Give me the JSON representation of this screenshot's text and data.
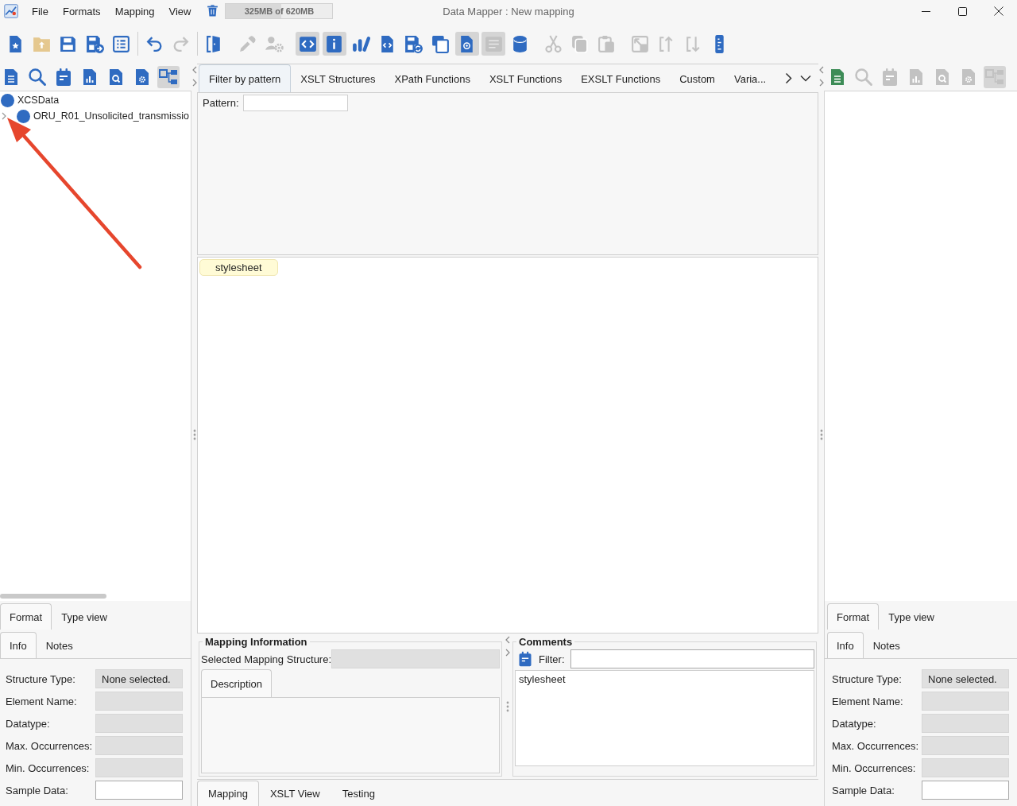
{
  "window": {
    "title": "Data Mapper : New mapping"
  },
  "menu": [
    "File",
    "Formats",
    "Mapping",
    "View"
  ],
  "memory": {
    "reading": "325MB of 620MB",
    "level": 0.52
  },
  "toolbar": {
    "groups": [
      {
        "divider": true,
        "tools": [
          {
            "disabled": false,
            "selected": false
          },
          {
            "disabled": false,
            "selected": false
          },
          {
            "disabled": false,
            "selected": false
          },
          {
            "disabled": false,
            "selected": false
          },
          {
            "disabled": false,
            "selected": false
          }
        ]
      },
      {
        "divider": true,
        "tools": [
          {
            "disabled": false,
            "selected": false
          },
          {
            "disabled": true,
            "selected": false
          }
        ]
      },
      {
        "divider": false,
        "tools": [
          {
            "disabled": false,
            "selected": false
          }
        ]
      },
      {
        "divider": false,
        "tools": [
          {
            "disabled": true,
            "selected": false
          },
          {
            "disabled": true,
            "selected": false
          }
        ]
      },
      {
        "divider": false,
        "tools": [
          {
            "disabled": false,
            "selected": true
          },
          {
            "disabled": false,
            "selected": true
          },
          {
            "disabled": false,
            "selected": false
          },
          {
            "disabled": false,
            "selected": false
          },
          {
            "disabled": false,
            "selected": false
          },
          {
            "disabled": false,
            "selected": false
          },
          {
            "disabled": false,
            "selected": true
          },
          {
            "disabled": true,
            "selected": true
          },
          {
            "disabled": false,
            "selected": false
          }
        ]
      },
      {
        "divider": false,
        "tools": [
          {
            "disabled": true,
            "selected": false
          },
          {
            "disabled": true,
            "selected": false
          },
          {
            "disabled": true,
            "selected": false
          }
        ]
      },
      {
        "divider": false,
        "tools": [
          {
            "disabled": true,
            "selected": false
          },
          {
            "disabled": true,
            "selected": false
          },
          {
            "disabled": true,
            "selected": false
          },
          {
            "disabled": false,
            "selected": false
          }
        ]
      }
    ]
  },
  "left_panel": {
    "tools": [
      {
        "disabled": false,
        "selected": false
      },
      {
        "disabled": false,
        "selected": false
      },
      {
        "disabled": false,
        "selected": false
      },
      {
        "disabled": false,
        "selected": false
      },
      {
        "disabled": false,
        "selected": false
      },
      {
        "disabled": false,
        "selected": false
      },
      {
        "disabled": false,
        "selected": true
      }
    ],
    "tree": [
      {
        "label": "XCSData",
        "children": [
          {
            "label": "ORU_R01_Unsolicited_transmissio",
            "expanded": false
          }
        ]
      }
    ],
    "annotations": [
      {
        "kind": "arrow"
      }
    ],
    "format_tabs": [
      {
        "label": "Format",
        "selected": true
      },
      {
        "label": "Type view",
        "selected": false
      }
    ],
    "info_tabs": [
      {
        "label": "Info",
        "selected": true
      },
      {
        "label": "Notes",
        "selected": false
      }
    ],
    "fields": [
      {
        "label": "Structure Type:",
        "value": "None selected.",
        "disabled": true
      },
      {
        "label": "Element Name:",
        "disabled": true
      },
      {
        "label": "Datatype:",
        "disabled": true
      },
      {
        "label": "Max. Occurrences:",
        "disabled": true
      },
      {
        "label": "Min. Occurrences:",
        "disabled": true
      },
      {
        "label": "Sample Data:",
        "disabled": false
      }
    ]
  },
  "center": {
    "tabs": [
      {
        "label": "Filter by pattern",
        "selected": true
      },
      {
        "label": "XSLT Structures",
        "selected": false
      },
      {
        "label": "XPath Functions",
        "selected": false
      },
      {
        "label": "XSLT Functions",
        "selected": false
      },
      {
        "label": "EXSLT Functions",
        "selected": false
      },
      {
        "label": "Custom",
        "selected": false
      },
      {
        "label": "Varia...",
        "selected": false
      }
    ],
    "pattern_label": "Pattern:",
    "canvas_nodes": [
      "stylesheet"
    ],
    "mapping_information": {
      "title": "Mapping Information",
      "structure_label": "Selected Mapping Structure:",
      "tabs": [
        {
          "label": "Description",
          "selected": true
        }
      ]
    },
    "comments": {
      "title": "Comments",
      "filter_label": "Filter:",
      "items": [
        "stylesheet"
      ]
    },
    "view_tabs": [
      {
        "label": "Mapping",
        "selected": true
      },
      {
        "label": "XSLT View",
        "selected": false
      },
      {
        "label": "Testing",
        "selected": false
      }
    ]
  },
  "right_panel": {
    "tools": [
      {
        "disabled": false,
        "selected": false,
        "color": "#3d8c57"
      },
      {
        "disabled": true,
        "selected": false
      },
      {
        "disabled": true,
        "selected": false
      },
      {
        "disabled": true,
        "selected": false
      },
      {
        "disabled": true,
        "selected": false
      },
      {
        "disabled": true,
        "selected": false
      },
      {
        "disabled": true,
        "selected": true
      }
    ],
    "format_tabs": [
      {
        "label": "Format",
        "selected": true
      },
      {
        "label": "Type view",
        "selected": false
      }
    ],
    "info_tabs": [
      {
        "label": "Info",
        "selected": true
      },
      {
        "label": "Notes",
        "selected": false
      }
    ],
    "fields": [
      {
        "label": "Structure Type:",
        "value": "None selected.",
        "disabled": true
      },
      {
        "label": "Element Name:",
        "disabled": true
      },
      {
        "label": "Datatype:",
        "disabled": true
      },
      {
        "label": "Max. Occurrences:",
        "disabled": true
      },
      {
        "label": "Min. Occurrences:",
        "disabled": true
      },
      {
        "label": "Sample Data:",
        "disabled": false
      }
    ]
  }
}
